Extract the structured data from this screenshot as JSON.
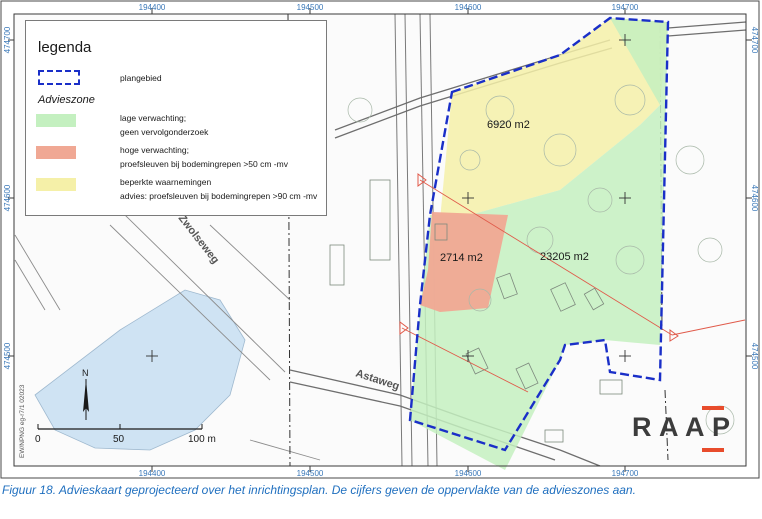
{
  "legend": {
    "title": "legenda",
    "planarea_label": "plangebied",
    "subtitle": "Advieszone",
    "items": [
      {
        "line1": "lage verwachting;",
        "line2": "geen vervolgonderzoek",
        "color": "#c4f0c0"
      },
      {
        "line1": "hoge verwachting;",
        "line2": "proefsleuven bij bodemingrepen >50 cm -mv",
        "color": "#f0a894"
      },
      {
        "line1": "beperkte waarnemingen",
        "line2": "advies: proefsleuven bij bodemingrepen >90 cm -mv",
        "color": "#f5f0a8"
      }
    ]
  },
  "grid": {
    "top": [
      "194400",
      "194500",
      "194600",
      "194700"
    ],
    "bottom": [
      "194400",
      "194500",
      "194600",
      "194700"
    ],
    "left": [
      "474700",
      "474600",
      "474500"
    ],
    "right": [
      "474700",
      "474600",
      "474500"
    ]
  },
  "zones": {
    "yellow_area": "6920 m2",
    "red_area": "2714 m2",
    "green_area": "23205 m2"
  },
  "streets": {
    "zwolseweg": "Zwolseweg",
    "astaweg": "Astaweg"
  },
  "scalebar": {
    "labels": [
      "0",
      "50",
      "100 m"
    ]
  },
  "north": "N",
  "file_ref": "EW/NPNG eg-r7/1 02023",
  "logo": {
    "letters": [
      "R",
      "A",
      "A",
      "P"
    ]
  },
  "caption": "Figuur 18. Advieskaart geprojecteerd over het inrichtingsplan. De cijfers geven de oppervlakte van de advieszones aan.",
  "colors": {
    "plan_boundary": "#1a2fc8",
    "zone_green": "#c4f0c0",
    "zone_red": "#f0a894",
    "zone_yellow": "#f5f0a8",
    "water": "#cfe3f3",
    "grid_label": "#3a78b8",
    "caption": "#1f6fbf",
    "logo_accent": "#e84c2c"
  }
}
